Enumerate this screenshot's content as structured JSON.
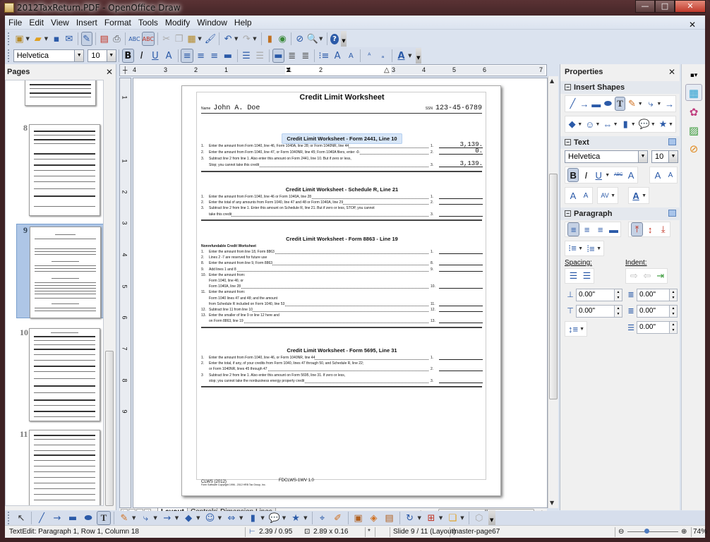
{
  "window": {
    "title": "2012TaxReturn.PDF - OpenOffice Draw",
    "buttons": {
      "minimize": "—",
      "maximize": "□",
      "close": "✕"
    }
  },
  "menu": [
    "File",
    "Edit",
    "View",
    "Insert",
    "Format",
    "Tools",
    "Modify",
    "Window",
    "Help"
  ],
  "toolbar_standard": {
    "icons": [
      "new-icon",
      "open-icon",
      "save-icon",
      "email-icon",
      "edit-file-icon",
      "export-pdf-icon",
      "print-icon",
      "spellcheck-icon",
      "autospellcheck-icon",
      "cut-icon",
      "copy-icon",
      "paste-icon",
      "clone-formatting-icon",
      "undo-icon",
      "redo-icon",
      "chart-icon",
      "gallery-icon",
      "navigator-icon",
      "zoom-icon",
      "help-icon"
    ]
  },
  "toolbar_formatting": {
    "font_name": "Helvetica",
    "font_size": "10",
    "bold": "B",
    "italic": "I",
    "underline": "U",
    "shadow": "A"
  },
  "pages_panel": {
    "title": "Pages",
    "close": "✕",
    "items": [
      {
        "number": "",
        "selected": false
      },
      {
        "number": "8",
        "selected": false
      },
      {
        "number": "9",
        "selected": true
      },
      {
        "number": "10",
        "selected": false
      },
      {
        "number": "11",
        "selected": false
      }
    ]
  },
  "ruler": {
    "h_labels": [
      "4",
      "3",
      "2",
      "1",
      "1",
      "2",
      "3",
      "4",
      "5",
      "6",
      "7"
    ],
    "v_labels": [
      "1",
      "1",
      "2",
      "3",
      "4",
      "5",
      "6",
      "7",
      "8",
      "9"
    ]
  },
  "document": {
    "title": "Credit Limit Worksheet",
    "name_label": "Name",
    "name_value": "John A. Doe",
    "ssn_label": "SSN",
    "ssn_value": "123-45-6789",
    "sections": [
      {
        "heading": "Credit Limit Worksheet - Form 2441, Line 10",
        "highlighted": true,
        "rows": [
          {
            "n": "1.",
            "text": "Enter the amount from Form 1040, line 46, Form 1040A, line 28; or Form 1040NR, line 44",
            "line": "1.",
            "amount": "3,139."
          },
          {
            "n": "2.",
            "text": "Enter the amount from Form 1040, line 47, or Form 1040NR, line 45; Form 1040A filers, enter -0-",
            "line": "2.",
            "amount": "0."
          },
          {
            "n": "3.",
            "text": "Subtract line 2 from line 1. Also enter this amount on Form 2441, line 10. But if zero or less,",
            "line": "",
            "amount": ""
          },
          {
            "n": "",
            "text": "Stop; you cannot take this credit",
            "line": "3.",
            "amount": "3,139."
          }
        ]
      },
      {
        "heading": "Credit Limit Worksheet - Schedule R, Line 21",
        "highlighted": false,
        "rows": [
          {
            "n": "1.",
            "text": "Enter the amount from Form 1040, line 46 or Form 1040A, line 28",
            "line": "1.",
            "amount": ""
          },
          {
            "n": "2.",
            "text": "Enter the total of any amounts from Form 1040, line 47 and 48 or Form 1040A, line 29",
            "line": "2.",
            "amount": ""
          },
          {
            "n": "3.",
            "text": "Subtract line 2 from line 1. Enter this amount on Schedule R, line 21. But if zero or less, STOP, you cannot",
            "line": "",
            "amount": ""
          },
          {
            "n": "",
            "text": "take this credit",
            "line": "3.",
            "amount": ""
          }
        ]
      },
      {
        "heading": "Credit Limit Worksheet - Form 8863 - Line 19",
        "subheading": "Nonrefundable Credit Worksheet",
        "highlighted": false,
        "rows": [
          {
            "n": "1.",
            "text": "Enter the amount from line 18, Form 8863",
            "line": "1.",
            "amount": ""
          },
          {
            "n": "2.",
            "text": "Lines 2 -7 are reserved for future use",
            "line": "",
            "amount": ""
          },
          {
            "n": "8.",
            "text": "Enter the amount from line 9, Form 8863",
            "line": "8.",
            "amount": ""
          },
          {
            "n": "9.",
            "text": "Add lines 1 and 8",
            "line": "9.",
            "amount": ""
          },
          {
            "n": "10.",
            "text": "Enter the amount from:",
            "line": "",
            "amount": ""
          },
          {
            "n": "",
            "text": "Form 1040, line 46; or",
            "line": "",
            "amount": ""
          },
          {
            "n": "",
            "text": "Form 1040A, line 28",
            "line": "10.",
            "amount": ""
          },
          {
            "n": "11.",
            "text": "Enter the amount from:",
            "line": "",
            "amount": ""
          },
          {
            "n": "",
            "text": "Form 1040 lines 47 and 48; and the amount",
            "line": "",
            "amount": ""
          },
          {
            "n": "",
            "text": "from Schedule R included on Form 1040, line 53",
            "line": "11.",
            "amount": ""
          },
          {
            "n": "12.",
            "text": "Subtract line 11 from line 10",
            "line": "12.",
            "amount": ""
          },
          {
            "n": "13.",
            "text": "Enter the smaller of line 9 or line 12 here and",
            "line": "",
            "amount": ""
          },
          {
            "n": "",
            "text": "on Form 8863, line 19",
            "line": "13.",
            "amount": ""
          }
        ]
      },
      {
        "heading": "Credit Limit Worksheet - Form 5695, Line 31",
        "highlighted": false,
        "rows": [
          {
            "n": "1.",
            "text": "Enter the amount from Form 1040, line 46, or Form 1040NR, line 44",
            "line": "1.",
            "amount": ""
          },
          {
            "n": "2.",
            "text": "Enter the total, if any, of your credits from Form 1040, lines 47 through 50, and Schedule R, line 22;",
            "line": "",
            "amount": ""
          },
          {
            "n": "",
            "text": "or Form 1040NR, lines 45 through 47",
            "line": "2.",
            "amount": ""
          },
          {
            "n": "3",
            "text": "Subtract line 2 from line 1. Also enter this amount on Form 5695, line 31. If zero or less,",
            "line": "",
            "amount": ""
          },
          {
            "n": "",
            "text": "stop; you cannot take the nonbusiness energy property credit",
            "line": "3.",
            "amount": ""
          }
        ]
      }
    ],
    "footer_left": "CLWS (2012)",
    "footer_copyright": "Form Software Copyright 1996 - 2012 HRB Tax Group, Inc.",
    "footer_right": "FDCLWS-1WV 1.0"
  },
  "layer_tabs": [
    "Layout",
    "Controls",
    "Dimension Lines"
  ],
  "properties": {
    "title": "Properties",
    "close": "✕",
    "insert_shapes": {
      "title": "Insert Shapes"
    },
    "text": {
      "title": "Text",
      "font_name": "Helvetica",
      "font_size": "10"
    },
    "paragraph": {
      "title": "Paragraph",
      "spacing_label": "Spacing:",
      "indent_label": "Indent:",
      "above_spacing": "0.00\"",
      "below_spacing": "0.00\"",
      "before_indent": "0.00\"",
      "after_indent": "0.00\"",
      "first_line_indent": "0.00\""
    }
  },
  "status": {
    "edit_state": "TextEdit: Paragraph 1, Row 1, Column 18",
    "position": "2.39 / 0.95",
    "size": "2.89 x 0.16",
    "modified": "*",
    "slide": "Slide 9 / 11 (Layout)",
    "master": "master-page67",
    "zoom": "74%",
    "zoom_fraction": 0.74
  }
}
